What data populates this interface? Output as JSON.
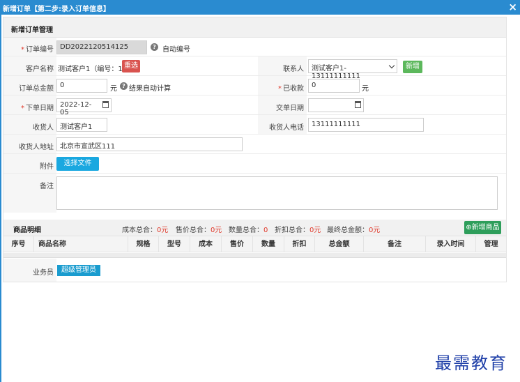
{
  "window": {
    "title": "新增订单【第二步:录入订单信息】",
    "close_glyph": "×"
  },
  "section": {
    "title": "新增订单管理"
  },
  "form": {
    "order_no": {
      "label": "订单编号",
      "value": "DD2022120514125",
      "hint": "自动编号"
    },
    "customer": {
      "label": "客户名称",
      "value": "测试客户1（编号：1）",
      "button": "重选"
    },
    "contact": {
      "label": "联系人",
      "selected": "测试客户1-13111111111",
      "button": "新增"
    },
    "total_amount": {
      "label": "订单总金额",
      "value": "0",
      "unit": "元",
      "hint": "结果自动计算"
    },
    "received": {
      "label": "已收款",
      "value": "0",
      "unit": "元"
    },
    "order_date": {
      "label": "下单日期",
      "value": "2022-12-05"
    },
    "delivery_date": {
      "label": "交单日期",
      "value": ""
    },
    "receiver": {
      "label": "收货人",
      "value": "测试客户1"
    },
    "receiver_phone": {
      "label": "收货人电话",
      "value": "13111111111"
    },
    "receiver_address": {
      "label": "收货人地址",
      "value": "北京市宣武区111"
    },
    "attachment": {
      "label": "附件",
      "button": "选择文件"
    },
    "remark": {
      "label": "备注",
      "value": ""
    }
  },
  "goods": {
    "title": "商品明细",
    "summary": [
      {
        "label": "成本总合：",
        "value": "0元"
      },
      {
        "label": "售价总合：",
        "value": "0元"
      },
      {
        "label": "数量总合：",
        "value": "0"
      },
      {
        "label": "折扣总合：",
        "value": "0元"
      },
      {
        "label": "最终总金额：",
        "value": "0元"
      }
    ],
    "add_button": "新增商品",
    "columns": [
      "序号",
      "商品名称",
      "规格",
      "型号",
      "成本",
      "售价",
      "数量",
      "折扣",
      "总金额",
      "备注",
      "录入时间",
      "管理"
    ]
  },
  "salesperson": {
    "label": "业务员",
    "value": "超级管理员"
  },
  "watermark": "最需教育",
  "colors": {
    "titlebar": "#2a8bd0",
    "required": "#e0392b",
    "red_button": "#d9534f",
    "green_button": "#5cb85c",
    "blue_button": "#1aa8e0"
  }
}
